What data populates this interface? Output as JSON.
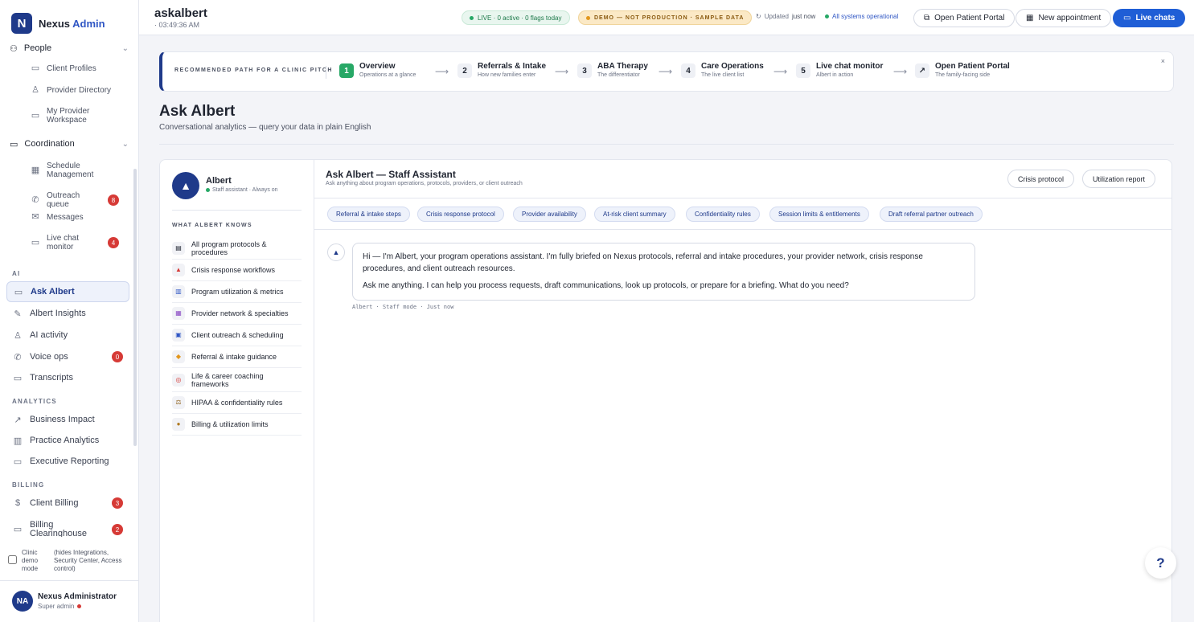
{
  "app": {
    "logo_mark": "N",
    "name": "Nexus",
    "name_accent": "Admin"
  },
  "sidebar": {
    "people_group": {
      "label": "People",
      "icon": "people-icon"
    },
    "people_items": [
      {
        "label": "Client Profiles",
        "icon": "document-icon"
      },
      {
        "label": "Provider Directory",
        "icon": "person-icon"
      },
      {
        "label": "My Provider Workspace",
        "icon": "monitor-icon"
      }
    ],
    "coordination_group": {
      "label": "Coordination",
      "icon": "chat-icon"
    },
    "coordination_items": [
      {
        "label": "Schedule Management",
        "icon": "calendar-icon",
        "badge": ""
      },
      {
        "label": "Outreach queue",
        "icon": "phone-icon",
        "badge": "8"
      },
      {
        "label": "Messages",
        "icon": "mail-icon",
        "badge": ""
      },
      {
        "label": "Live chat monitor",
        "icon": "monitor-icon",
        "badge": "4"
      }
    ],
    "sections": {
      "ai": "AI",
      "analytics": "ANALYTICS",
      "billing": "BILLING"
    },
    "ai_items": [
      {
        "label": "Ask Albert",
        "icon": "chat-icon",
        "active": true,
        "badge": ""
      },
      {
        "label": "Albert Insights",
        "icon": "pen-icon",
        "badge": ""
      },
      {
        "label": "AI activity",
        "icon": "person-icon",
        "badge": ""
      },
      {
        "label": "Voice ops",
        "icon": "phone-icon",
        "badge": "0"
      },
      {
        "label": "Transcripts",
        "icon": "document-icon",
        "badge": ""
      }
    ],
    "analytics_items": [
      {
        "label": "Business Impact",
        "icon": "trend-icon"
      },
      {
        "label": "Practice Analytics",
        "icon": "bar-chart-icon"
      },
      {
        "label": "Executive Reporting",
        "icon": "document-icon"
      }
    ],
    "billing_items": [
      {
        "label": "Client Billing",
        "icon": "dollar-icon",
        "badge": "3"
      },
      {
        "label": "Billing Clearinghouse",
        "icon": "card-icon",
        "badge": "2"
      }
    ],
    "demo_mode": {
      "label": "Clinic demo mode",
      "note": "(hides Integrations, Security Center, Access control)",
      "checked": false
    },
    "user": {
      "initials": "NA",
      "name": "Nexus Administrator",
      "role": "Super admin"
    }
  },
  "topbar": {
    "title": "askalbert",
    "time": "· 03:49:36 AM",
    "live": "LIVE · 0 active · 0 flags today",
    "demo": "DEMO — NOT PRODUCTION · SAMPLE DATA",
    "updated_label": "Updated",
    "updated_value": "just now",
    "systems": "All systems operational",
    "buttons": {
      "portal": "Open Patient Portal",
      "appointment": "New appointment",
      "live_chats": "Live chats"
    }
  },
  "path": {
    "label": "RECOMMENDED PATH FOR A CLINIC PITCH",
    "steps": [
      {
        "num": "1",
        "title": "Overview",
        "sub": "Operations at a glance"
      },
      {
        "num": "2",
        "title": "Referrals & Intake",
        "sub": "How new families enter"
      },
      {
        "num": "3",
        "title": "ABA Therapy",
        "sub": "The differentiator"
      },
      {
        "num": "4",
        "title": "Care Operations",
        "sub": "The live client list"
      },
      {
        "num": "5",
        "title": "Live chat monitor",
        "sub": "Albert in action"
      },
      {
        "num": "↗",
        "title": "Open Patient Portal",
        "sub": "The family-facing side"
      }
    ],
    "close": "×"
  },
  "page": {
    "title": "Ask Albert",
    "subtitle": "Conversational analytics — query your data in plain English"
  },
  "knowledge": {
    "name": "Albert",
    "role": "Staff assistant · Always on",
    "label": "WHAT ALBERT KNOWS",
    "items": [
      {
        "icon": "clipboard-icon",
        "glyph": "▤",
        "label": "All program protocols & procedures"
      },
      {
        "icon": "alert-icon",
        "glyph": "▲",
        "label": "Crisis response workflows"
      },
      {
        "icon": "chart-icon",
        "glyph": "▥",
        "label": "Program utilization & metrics"
      },
      {
        "icon": "book-icon",
        "glyph": "▦",
        "label": "Provider network & specialties"
      },
      {
        "icon": "calendar-icon",
        "glyph": "▣",
        "label": "Client outreach & scheduling"
      },
      {
        "icon": "handshake-icon",
        "glyph": "◆",
        "label": "Referral & intake guidance"
      },
      {
        "icon": "target-icon",
        "glyph": "◎",
        "label": "Life & career coaching frameworks"
      },
      {
        "icon": "scales-icon",
        "glyph": "⚖",
        "label": "HIPAA & confidentiality rules"
      },
      {
        "icon": "money-bag-icon",
        "glyph": "●",
        "label": "Billing & utilization limits"
      }
    ]
  },
  "chat": {
    "title": "Ask Albert — Staff Assistant",
    "subtitle": "Ask anything about program operations, protocols, providers, or client outreach",
    "buttons": {
      "crisis": "Crisis protocol",
      "utilization": "Utilization report"
    },
    "chips": [
      "Referral & intake steps",
      "Crisis response protocol",
      "Provider availability",
      "At-risk client summary",
      "Confidentiality rules",
      "Session limits & entitlements",
      "Draft referral partner outreach"
    ],
    "message": {
      "p1": "Hi — I'm Albert, your program operations assistant. I'm fully briefed on Nexus protocols, referral and intake procedures, your provider network, crisis response procedures, and client outreach resources.",
      "p2": "Ask me anything. I can help you process requests, draft communications, look up protocols, or prepare for a briefing. What do you need?"
    },
    "meta": "Albert · Staff mode · Just now"
  },
  "help": "?"
}
